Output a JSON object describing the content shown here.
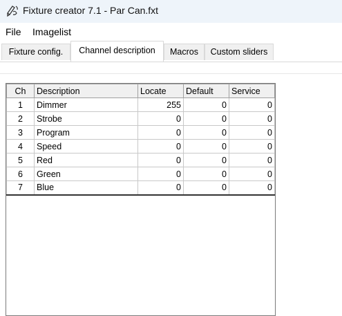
{
  "window": {
    "title": "Fixture creator 7.1 - Par Can.fxt",
    "icon": "fixture-pencil-icon"
  },
  "menu": [
    "File",
    "Imagelist"
  ],
  "tabs": [
    {
      "label": "Fixture config.",
      "active": false
    },
    {
      "label": "Channel description",
      "active": true
    },
    {
      "label": "Macros",
      "active": false
    },
    {
      "label": "Custom sliders",
      "active": false
    }
  ],
  "grid": {
    "columns": [
      "Ch",
      "Description",
      "Locate",
      "Default",
      "Service"
    ],
    "rows": [
      [
        "1",
        "Dimmer",
        "255",
        "0",
        "0"
      ],
      [
        "2",
        "Strobe",
        "0",
        "0",
        "0"
      ],
      [
        "3",
        "Program",
        "0",
        "0",
        "0"
      ],
      [
        "4",
        "Speed",
        "0",
        "0",
        "0"
      ],
      [
        "5",
        "Red",
        "0",
        "0",
        "0"
      ],
      [
        "6",
        "Green",
        "0",
        "0",
        "0"
      ],
      [
        "7",
        "Blue",
        "0",
        "0",
        "0"
      ]
    ]
  }
}
